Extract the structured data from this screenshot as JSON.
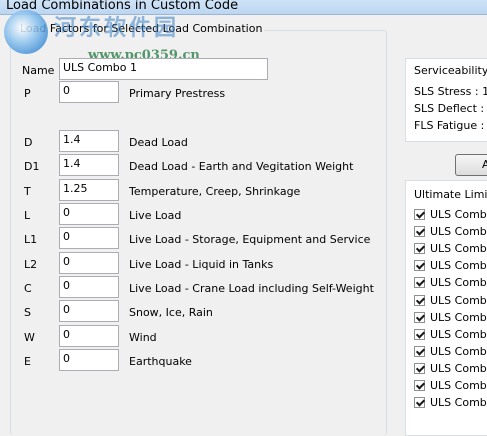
{
  "window": {
    "title": "Load Combinations in Custom Code"
  },
  "watermark": {
    "text_cn": "河东软件园",
    "url": "www.pc0359.cn"
  },
  "load_factors": {
    "legend": "Load Factors for Selected Load Combination",
    "name_label": "Name",
    "name_value": "ULS Combo  1",
    "rows": [
      {
        "code": "P",
        "value": "0",
        "description": "Primary Prestress"
      },
      {
        "code": "D",
        "value": "1.4",
        "description": "Dead Load"
      },
      {
        "code": "D1",
        "value": "1.4",
        "description": "Dead Load - Earth and Vegitation Weight"
      },
      {
        "code": "T",
        "value": "1.25",
        "description": "Temperature, Creep, Shrinkage"
      },
      {
        "code": "L",
        "value": "0",
        "description": "Live Load"
      },
      {
        "code": "L1",
        "value": "0",
        "description": "Live Load - Storage, Equipment and Service"
      },
      {
        "code": "L2",
        "value": "0",
        "description": "Live Load - Liquid in Tanks"
      },
      {
        "code": "C",
        "value": "0",
        "description": "Live Load - Crane Load including Self-Weight"
      },
      {
        "code": "S",
        "value": "0",
        "description": "Snow, Ice, Rain"
      },
      {
        "code": "W",
        "value": "0",
        "description": "Wind"
      },
      {
        "code": "E",
        "value": "0",
        "description": "Earthquake"
      }
    ]
  },
  "serviceability": {
    "title": "Serviceability Li",
    "rows": [
      "SLS Stress : 1",
      "SLS Deflect : 1",
      "FLS Fatigue : 1"
    ]
  },
  "add_button": {
    "label": "A"
  },
  "ultimate": {
    "title": "Ultimate Limit S",
    "items": [
      {
        "label": "ULS Combo",
        "checked": true
      },
      {
        "label": "ULS Combo",
        "checked": true
      },
      {
        "label": "ULS Combo",
        "checked": true
      },
      {
        "label": "ULS Combo",
        "checked": true
      },
      {
        "label": "ULS Combo",
        "checked": true
      },
      {
        "label": "ULS Combo",
        "checked": true
      },
      {
        "label": "ULS Combo",
        "checked": true
      },
      {
        "label": "ULS Combo",
        "checked": true
      },
      {
        "label": "ULS Combo",
        "checked": true
      },
      {
        "label": "ULS Combo",
        "checked": true
      },
      {
        "label": "ULS Combo",
        "checked": true
      },
      {
        "label": "ULS Combo",
        "checked": true
      }
    ]
  }
}
